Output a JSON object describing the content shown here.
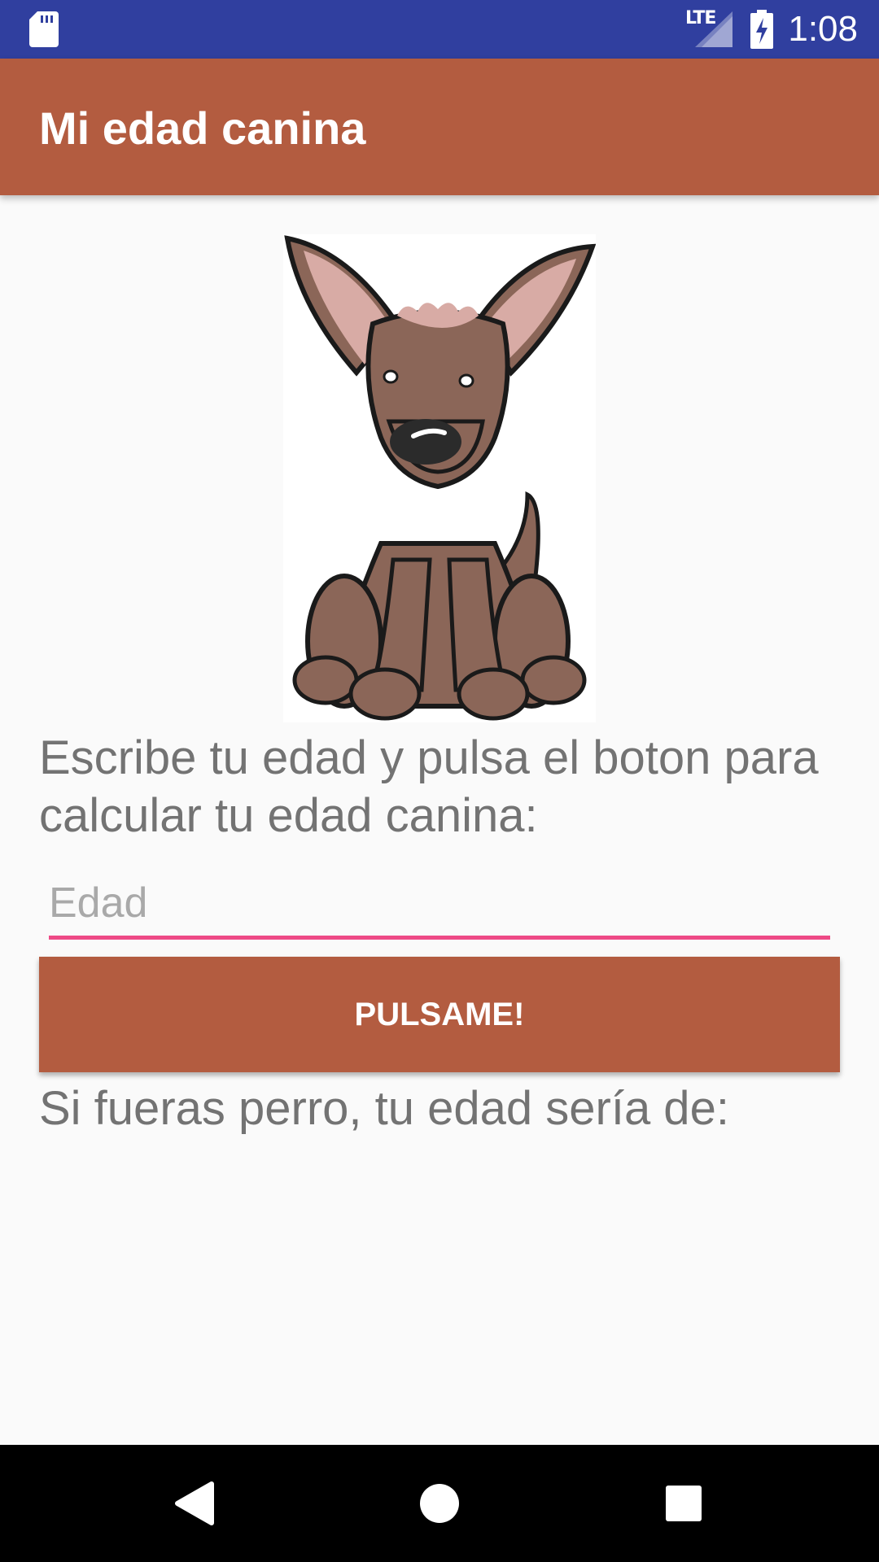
{
  "status_bar": {
    "network": "LTE",
    "time": "1:08",
    "icons": [
      "sd-card-icon",
      "signal-icon",
      "battery-charging-icon"
    ]
  },
  "app_bar": {
    "title": "Mi edad canina"
  },
  "main": {
    "image": "cartoon-dog-illustration",
    "instructions": "Escribe tu edad y pulsa el boton para calcular tu edad canina:",
    "age_input": {
      "value": "",
      "placeholder": "Edad"
    },
    "button_label": "PULSAME!",
    "result_text": "Si fueras perro, tu edad sería de:"
  },
  "nav_bar": {
    "icons": [
      "back-icon",
      "home-icon",
      "recents-icon"
    ]
  },
  "colors": {
    "status_bar": "#303f9f",
    "primary": "#b35c40",
    "accent": "#ee4a86",
    "text_secondary": "#737373"
  }
}
